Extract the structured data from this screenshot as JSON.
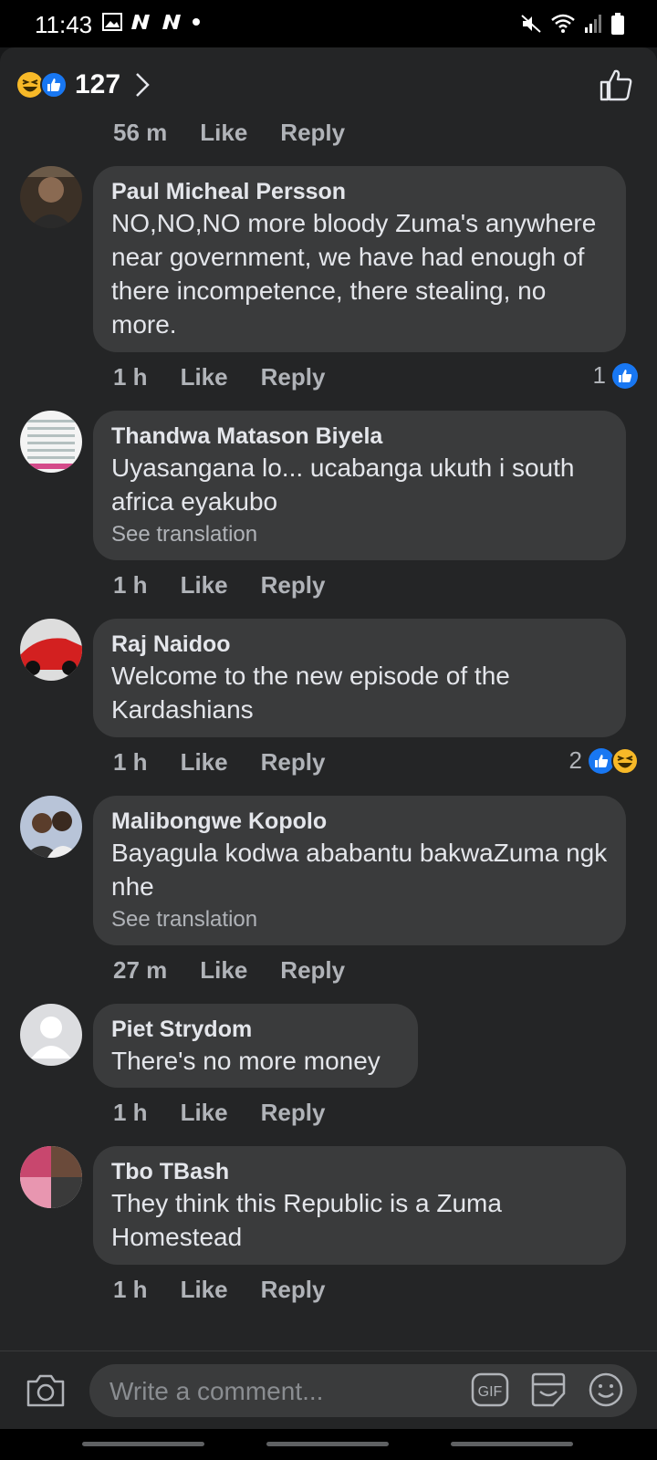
{
  "status": {
    "time": "11:43"
  },
  "header": {
    "reaction_count": "127"
  },
  "top_meta": {
    "time": "56 m",
    "like": "Like",
    "reply": "Reply"
  },
  "comments": [
    {
      "author": "Paul Micheal Persson",
      "text": "NO,NO,NO more bloody Zuma's anywhere near government, we have had enough of there incompetence, there stealing, no more.",
      "time": "1 h",
      "like": "Like",
      "reply": "Reply",
      "reactions": "1"
    },
    {
      "author": "Thandwa Matason Biyela",
      "text": "Uyasangana lo... ucabanga ukuth i south africa eyakubo",
      "translation": "See translation",
      "time": "1 h",
      "like": "Like",
      "reply": "Reply"
    },
    {
      "author": "Raj Naidoo",
      "text": "Welcome to the new episode of the Kardashians",
      "time": "1 h",
      "like": "Like",
      "reply": "Reply",
      "reactions": "2"
    },
    {
      "author": "Malibongwe Kopolo",
      "text": "Bayagula kodwa ababantu bakwaZuma ngk nhe",
      "translation": "See translation",
      "time": "27 m",
      "like": "Like",
      "reply": "Reply"
    },
    {
      "author": "Piet Strydom",
      "text": "There's no more money",
      "time": "1 h",
      "like": "Like",
      "reply": "Reply"
    },
    {
      "author": "Tbo TBash",
      "text": "They think this Republic is a Zuma Homestead",
      "time": "1 h",
      "like": "Like",
      "reply": "Reply"
    }
  ],
  "composer": {
    "placeholder": "Write a comment..."
  },
  "colors": {
    "like_blue": "#1877f2",
    "haha_yellow": "#f7b928",
    "bubble": "#3a3b3c"
  }
}
